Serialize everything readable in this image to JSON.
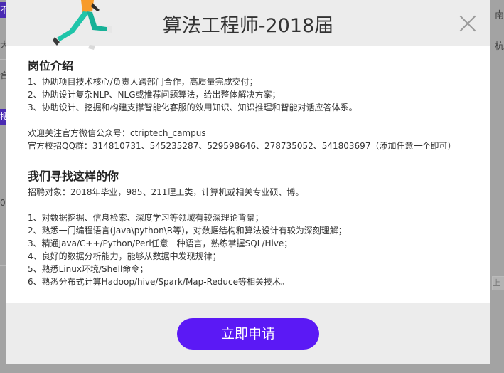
{
  "background": {
    "left_tags": [
      "不",
      "搜"
    ],
    "left_texts": [
      "大",
      "合",
      "0."
    ],
    "right_texts": [
      "南",
      "杭"
    ],
    "right_box": "上"
  },
  "modal": {
    "title": "算法工程师-2018届",
    "close_icon": "close-icon",
    "section1": {
      "title": "岗位介绍",
      "lines": [
        "1、协助项目技术核心/负责人跨部门合作，高质量完成交付；",
        "2、协助设计复杂NLP、NLG或推荐问题算法，给出整体解决方案；",
        "3、协助设计、挖掘和构建支撑智能化客服的效用知识、知识推理和智能对话应答体系。"
      ],
      "wechat": "欢迎关注官方微信公众号：ctriptech_campus",
      "qq": "官方校招QQ群：314810731、545235287、529598646、278735052、541803697（添加任意一个即可）"
    },
    "section2": {
      "title": "我们寻找这样的你",
      "target": "招聘对象：2018年毕业，985、211理工类，计算机或相关专业硕、博。",
      "lines": [
        "1、对数据挖掘、信息检索、深度学习等领域有较深理论背景；",
        "2、熟悉一门编程语言(Java\\python\\R等)，对数据结构和算法设计有较为深刻理解；",
        "3、精通Java/C++/Python/Perl任意一种语言，熟练掌握SQL/Hive；",
        "4、良好的数据分析能力，能够从数据中发现规律；",
        "5、熟悉Linux环境/Shell命令；",
        "6、熟悉分布式计算Hadoop/hive/Spark/Map-Reduce等相关技术。"
      ]
    },
    "apply_label": "立即申请"
  },
  "colors": {
    "accent": "#5b19f5",
    "mascot_teal": "#1fc5a9",
    "mascot_orange": "#f79b2b"
  }
}
